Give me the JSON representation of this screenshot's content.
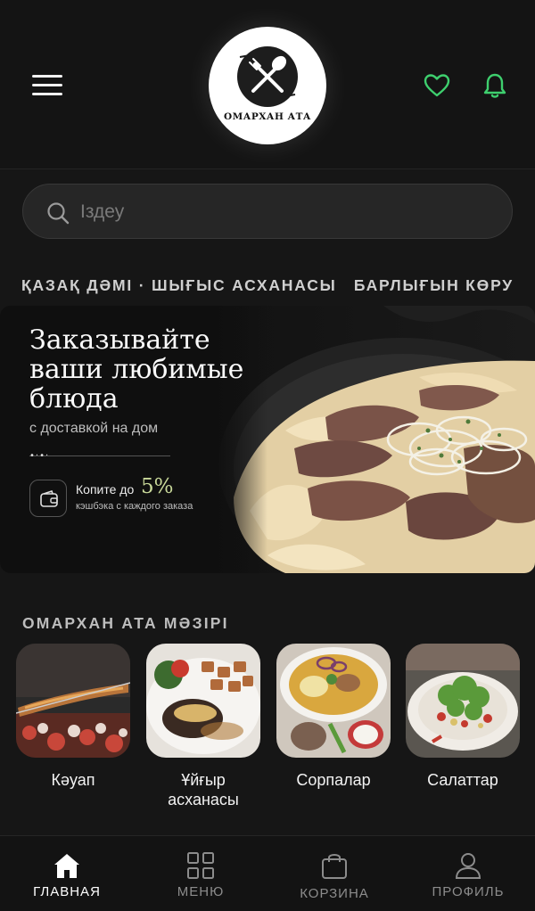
{
  "header": {
    "logo_text": "ОМАРХАН АТА"
  },
  "search": {
    "placeholder": "Іздеу"
  },
  "category_line": {
    "text": "ҚАЗАҚ ДӘМІ · ШЫҒЫС АСХАНАСЫ",
    "see_all": "БАРЛЫҒЫН КӨРУ"
  },
  "banner": {
    "title": "Заказывайте ваши любимые блюда",
    "subtitle": "с доставкой на дом",
    "cashback_prefix": "Копите до",
    "cashback_percent": "5%",
    "cashback_note": "кэшбэка с каждого заказа"
  },
  "menu": {
    "title": "ОМАРХАН АТА МӘЗІРІ",
    "items": [
      {
        "label": "Кәуап"
      },
      {
        "label": "Ұйғыр асханасы"
      },
      {
        "label": "Сорпалар"
      },
      {
        "label": "Салаттар"
      }
    ]
  },
  "bottom_nav": {
    "items": [
      {
        "label": "ГЛАВНАЯ",
        "icon": "home-icon",
        "active": true
      },
      {
        "label": "МЕНЮ",
        "icon": "grid-icon",
        "active": false
      },
      {
        "label": "КОРЗИНА",
        "icon": "bag-icon",
        "active": false
      },
      {
        "label": "ПРОФИЛЬ",
        "icon": "user-icon",
        "active": false
      }
    ]
  },
  "colors": {
    "accent_green": "#3ecf6e",
    "cashback_highlight": "#c9d99a",
    "background": "#161616"
  }
}
